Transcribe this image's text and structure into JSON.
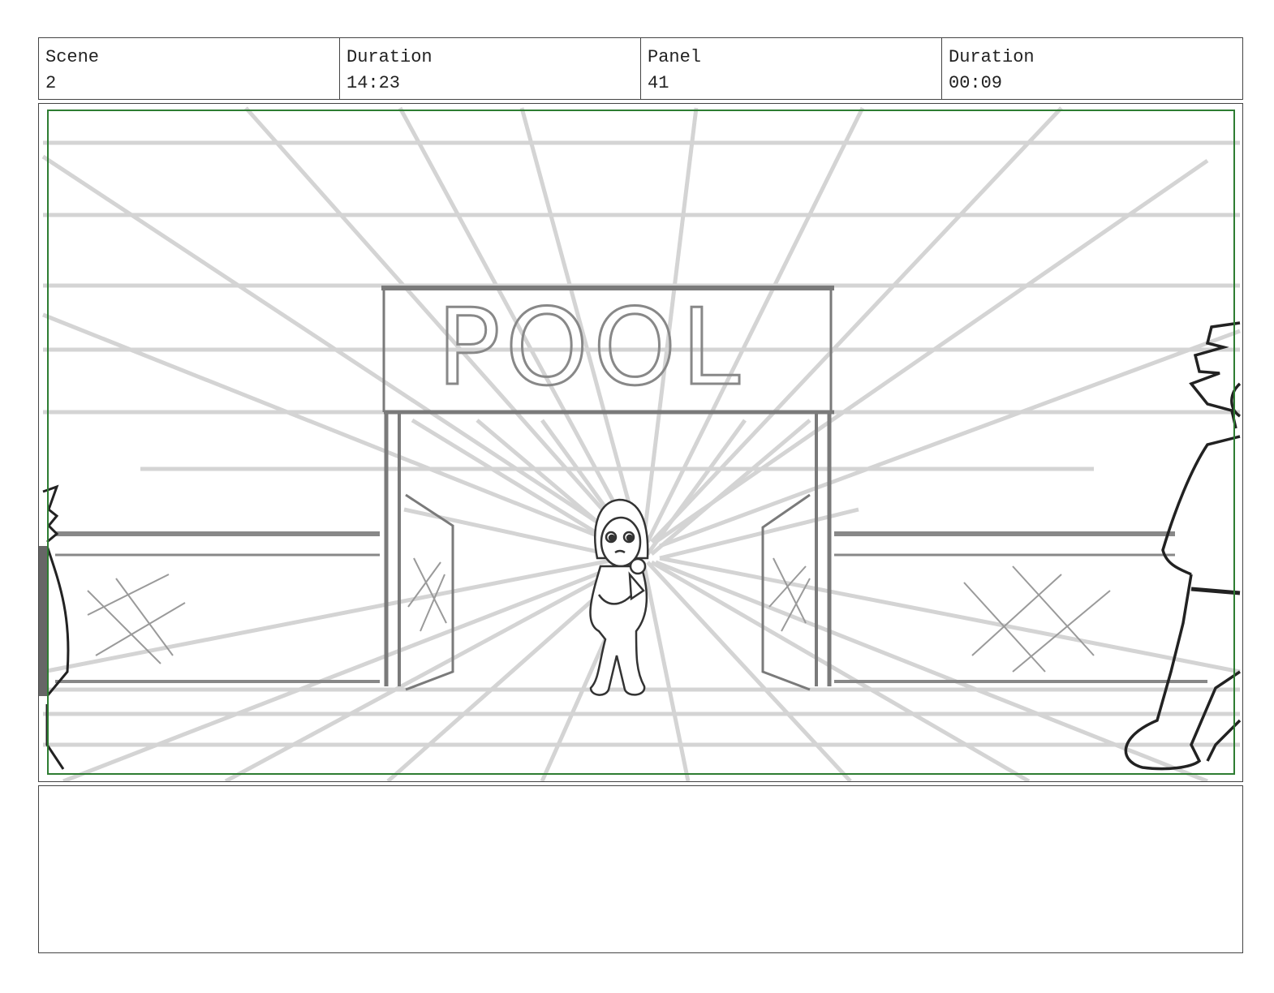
{
  "header": {
    "scene_label": "Scene",
    "scene_value": "2",
    "scene_duration_label": "Duration",
    "scene_duration_value": "14:23",
    "panel_label": "Panel",
    "panel_value": "41",
    "panel_duration_label": "Duration",
    "panel_duration_value": "00:09"
  },
  "panel": {
    "sign_text": "POOL",
    "safe_frame_color": "#2e7d32"
  },
  "notes": {
    "text": ""
  }
}
